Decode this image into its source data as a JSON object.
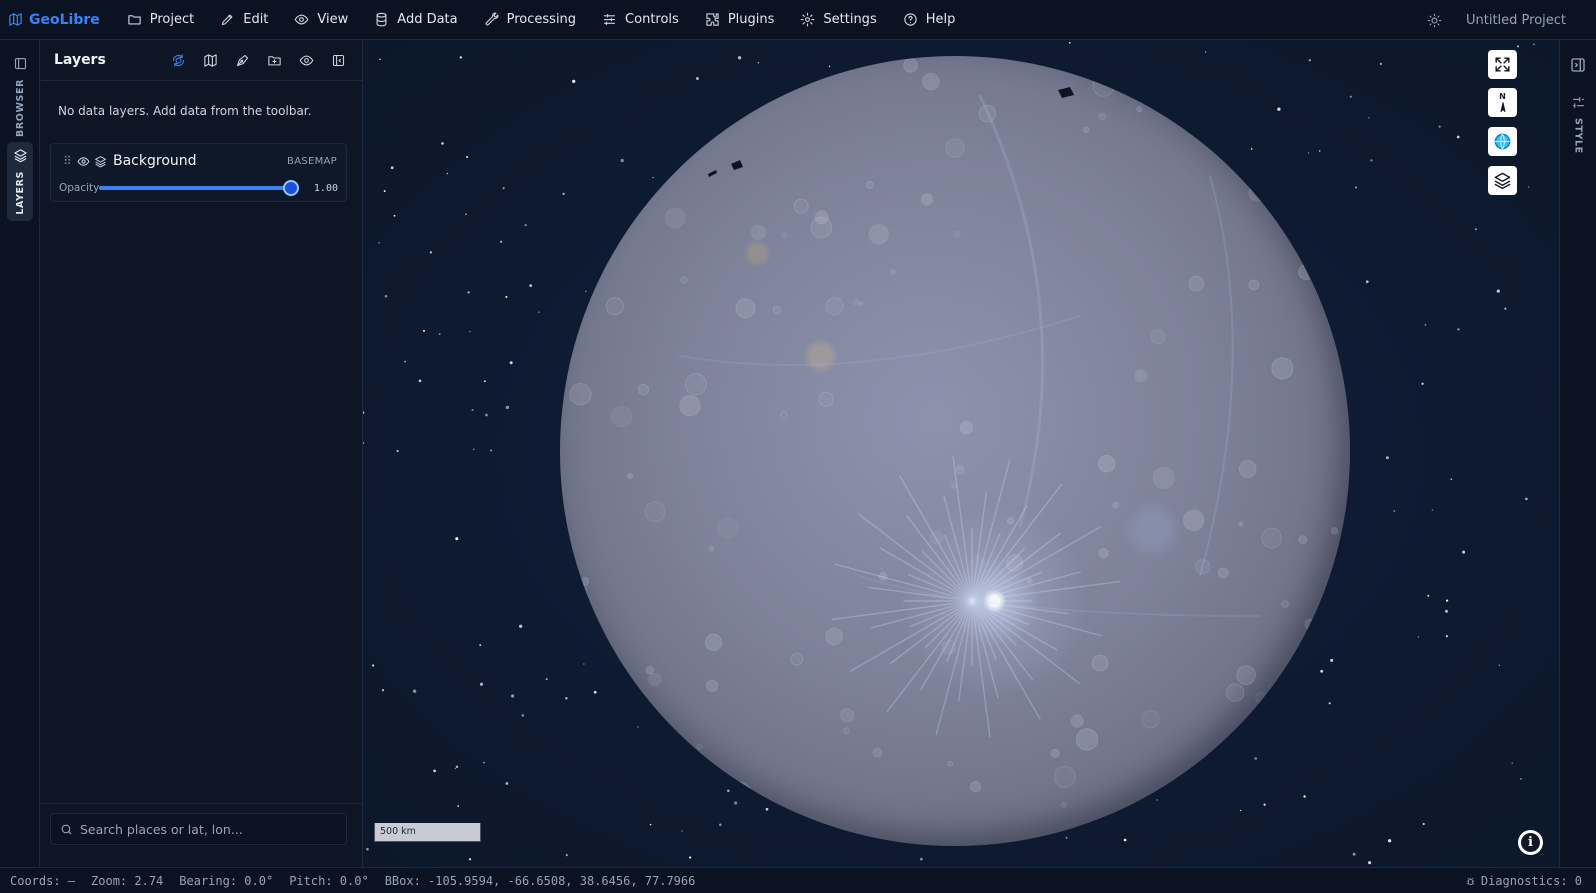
{
  "app": {
    "name": "GeoLibre",
    "project_name": "Untitled Project"
  },
  "menu": [
    {
      "label": "Project",
      "icon": "folder-icon"
    },
    {
      "label": "Edit",
      "icon": "pencil-icon"
    },
    {
      "label": "View",
      "icon": "eye-icon"
    },
    {
      "label": "Add Data",
      "icon": "database-icon"
    },
    {
      "label": "Processing",
      "icon": "wrench-icon"
    },
    {
      "label": "Controls",
      "icon": "sliders-icon"
    },
    {
      "label": "Plugins",
      "icon": "puzzle-icon"
    },
    {
      "label": "Settings",
      "icon": "gear-icon"
    },
    {
      "label": "Help",
      "icon": "help-circle-icon"
    }
  ],
  "left_rail": {
    "browser_label": "BROWSER",
    "layers_label": "LAYERS",
    "active": "layers"
  },
  "layers_panel": {
    "title": "Layers",
    "empty_message": "No data layers. Add data from the toolbar.",
    "tools": [
      "globe-tool-icon",
      "map-icon",
      "draw-icon",
      "folder-plus-icon",
      "eye-icon",
      "sidebar-icon"
    ],
    "layers": [
      {
        "name": "Background",
        "tag": "BASEMAP",
        "opacity_label": "Opacity",
        "opacity": 1.0,
        "opacity_text": "1.00",
        "visible": true
      }
    ],
    "search": {
      "placeholder": "Search places or lat, lon..."
    }
  },
  "map": {
    "scale_text": "500 km",
    "controls": [
      "fullscreen-icon",
      "compass-icon",
      "globe-icon",
      "layers-icon"
    ],
    "compass_label": "N",
    "attribution_label": "i"
  },
  "right_rail": {
    "style_label": "STYLE"
  },
  "status": {
    "coords": "Coords: —",
    "zoom": "Zoom: 2.74",
    "bearing": "Bearing: 0.0°",
    "pitch": "Pitch: 0.0°",
    "bbox": "BBox: -105.9594, -66.6508, 38.6456, 77.7966",
    "diagnostics": "Diagnostics: 0"
  },
  "colors": {
    "accent": "#3b82f6",
    "background": "#0f1729",
    "panel": "#0e1626"
  }
}
